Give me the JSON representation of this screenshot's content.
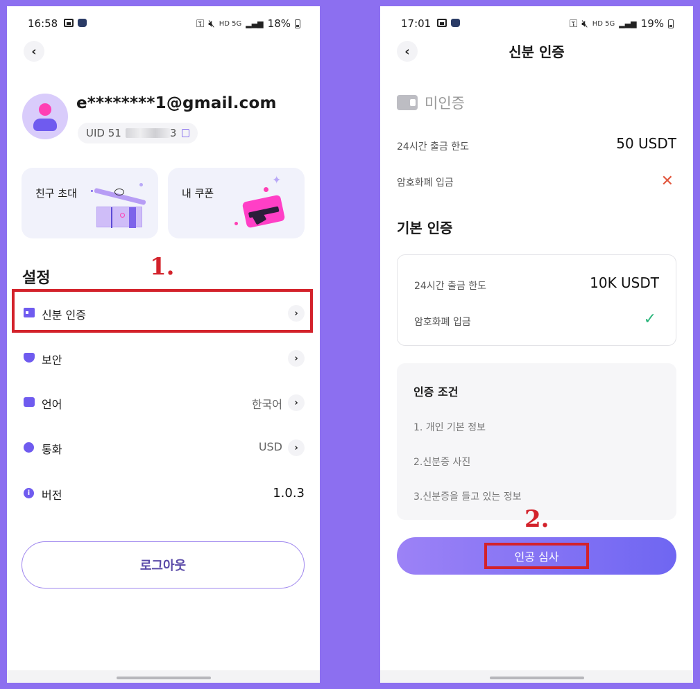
{
  "left": {
    "status": {
      "time": "16:58",
      "battery": "18%",
      "network": "HD 5G"
    },
    "profile": {
      "email": "e********1@gmail.com",
      "uid_prefix": "UID 51",
      "uid_suffix": "3"
    },
    "cards": [
      {
        "title": "친구 초대"
      },
      {
        "title": "내 쿠폰"
      }
    ],
    "section_title": "설정",
    "annotation": "1.",
    "menu": [
      {
        "label": "신분 인증",
        "value": ""
      },
      {
        "label": "보안",
        "value": ""
      },
      {
        "label": "언어",
        "value": "한국어"
      },
      {
        "label": "통화",
        "value": "USD"
      },
      {
        "label": "버전",
        "value": "1.0.3"
      }
    ],
    "logout": "로그아웃"
  },
  "right": {
    "status": {
      "time": "17:01",
      "battery": "19%",
      "network": "HD 5G"
    },
    "title": "신분 인증",
    "unverified": {
      "label": "미인증",
      "withdraw_label": "24시간 출금 한도",
      "withdraw_value": "50 USDT",
      "deposit_label": "암호화폐 입금"
    },
    "basic": {
      "title": "기본 인증",
      "withdraw_label": "24시간 출금 한도",
      "withdraw_value": "10K USDT",
      "deposit_label": "암호화폐 입금"
    },
    "conditions": {
      "title": "인증 조건",
      "items": [
        "1. 개인 기본 정보",
        "2.신분증 사진",
        "3.신분증을 들고 있는 정보"
      ]
    },
    "annotation": "2.",
    "button": "인공 심사"
  },
  "colors": {
    "accent": "#6f5bef",
    "highlight": "#d3222b",
    "pink": "#ff3fb4",
    "background": "#8c6ff0"
  },
  "icons": [
    "back-icon",
    "id-card-icon",
    "shield-icon",
    "language-icon",
    "currency-icon",
    "info-icon",
    "copy-icon",
    "close-icon",
    "check-icon"
  ]
}
